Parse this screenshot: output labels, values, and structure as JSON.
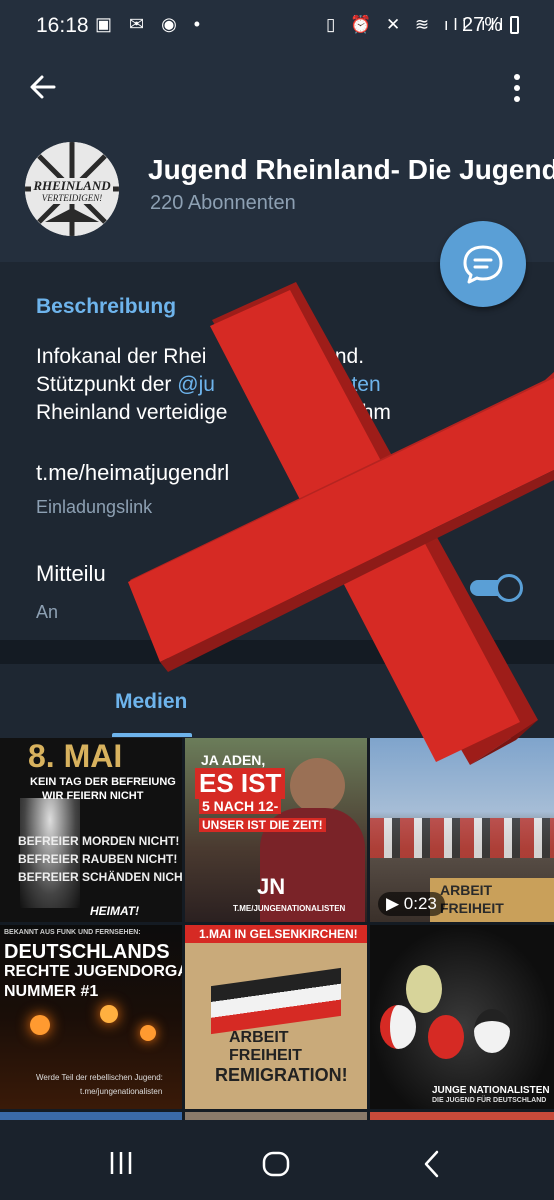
{
  "status": {
    "time": "16:18",
    "battery": "27%"
  },
  "channel": {
    "title": "Jugend Rheinland- Die Jugend",
    "subscribers": "220 Abonnenten",
    "avatar_text": [
      "RHEINLAND",
      "VERTEIDIGEN!"
    ]
  },
  "info": {
    "description_label": "Beschreibung",
    "description_lines": [
      "Infokanal der Rhei",
      "ugend.",
      "Stützpunkt der ",
      "@ju",
      "alisten",
      "Rheinland verteidige",
      "aufnahm"
    ],
    "link": "t.me/heimatjugendrl",
    "link_label": "Einladungslink",
    "notifications_label": "Mitteilu",
    "notifications_state": "An"
  },
  "tabs": {
    "media": "Medien"
  },
  "media": {
    "tile1": {
      "t1": "8. MAI",
      "t2": "KEIN TAG DER BEFREIUNG",
      "t3": "WIR FEIERN NICHT",
      "t4": "BEFREIER MORDEN NICHT!",
      "t5": "BEFREIER RAUBEN NICHT!",
      "t6": "BEFREIER SCHÄNDEN NICHT!",
      "t7": "HEIMAT!"
    },
    "tile2": {
      "t1": "JA ADEN,",
      "t2": "ES IST",
      "t3": "5 NACH 12-",
      "t4": "UNSER IST DIE ZEIT!",
      "t5": "JN",
      "t6": "T.ME/JUNGENATIONALISTEN"
    },
    "tile3": {
      "duration": "0:23",
      "t1": "ARBEIT",
      "t2": "FREIHEIT"
    },
    "tile4": {
      "t0": "BEKANNT AUS FUNK UND FERNSEHEN:",
      "t1": "DEUTSCHLANDS",
      "t2": "RECHTE JUGENDORGA",
      "t3": "NUMMER #1",
      "t4": "Werde Teil der rebellischen Jugend:",
      "t5": "t.me/jungenationalisten"
    },
    "tile5": {
      "t1": "1.MAI IN GELSENKIRCHEN!",
      "t2": "ARBEIT",
      "t3": "FREIHEIT",
      "t4": "REMIGRATION!"
    },
    "tile6": {
      "t1": "JUNGE NATIONALISTEN",
      "t2": "DIE JUGEND FÜR DEUTSCHLAND"
    }
  },
  "colors": {
    "accent": "#6eb4ec",
    "header_bg": "#242f3d",
    "overlay_red": "#d62a24"
  }
}
